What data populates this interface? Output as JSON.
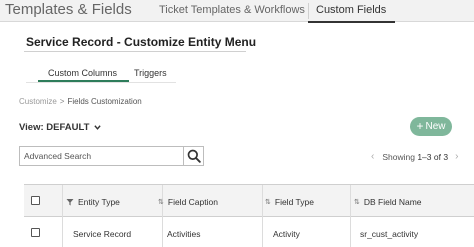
{
  "app": {
    "title": "Templates & Fields"
  },
  "top_tabs": [
    {
      "label": "Ticket Templates & Workflows",
      "active": false
    },
    {
      "label": "Custom Fields",
      "active": true
    }
  ],
  "page": {
    "title": "Service Record - Customize Entity Menu"
  },
  "sub_tabs": [
    {
      "label": "Custom Columns",
      "active": true
    },
    {
      "label": "Triggers",
      "active": false
    }
  ],
  "breadcrumb": {
    "root": "Customize",
    "separator": ">",
    "current": "Fields Customization"
  },
  "view": {
    "label": "View: DEFAULT"
  },
  "toolbar": {
    "new_label": "New"
  },
  "search": {
    "placeholder": "Advanced Search",
    "value": ""
  },
  "pager": {
    "text_prefix": "Showing",
    "range": "1–3 of 3"
  },
  "grid": {
    "columns": [
      "Entity Type",
      "Field Caption",
      "Field Type",
      "DB Field Name"
    ],
    "rows": [
      [
        "Service Record",
        "Activities",
        "Activity",
        "sr_cust_activity"
      ]
    ]
  },
  "colors": {
    "accent_green": "#2e7d5b",
    "new_button": "#7fb79b"
  }
}
